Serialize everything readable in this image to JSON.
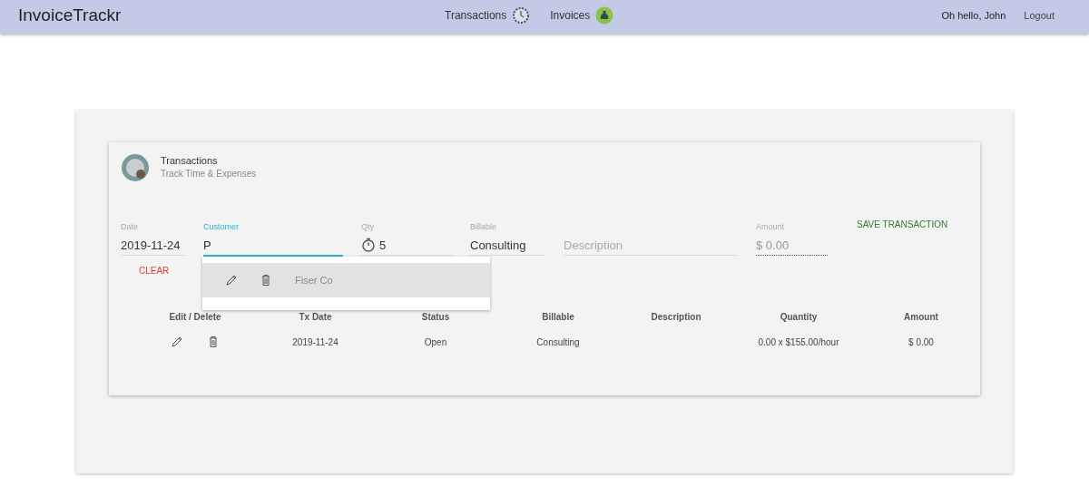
{
  "nav": {
    "brand": "InvoiceTrackr",
    "links": [
      {
        "label": "Transactions"
      },
      {
        "label": "Invoices"
      }
    ],
    "greeting": "Oh hello, John",
    "logout": "Logout"
  },
  "card": {
    "title": "Transactions",
    "subtitle": "Track Time & Expenses"
  },
  "fields": [
    {
      "kind": "text",
      "label": "Date",
      "value": "2019-11-24",
      "focused": false,
      "disabled": false
    },
    {
      "kind": "text",
      "label": "Customer",
      "value": "P",
      "focused": true,
      "disabled": false
    },
    {
      "kind": "qty",
      "label": "Qty",
      "value": "5",
      "focused": false,
      "disabled": false
    },
    {
      "kind": "text",
      "label": "Billable",
      "value": "Consulting",
      "focused": false,
      "disabled": false
    },
    {
      "kind": "text",
      "placeholder": "Description",
      "focused": false,
      "disabled": false
    },
    {
      "kind": "text",
      "label": "Amount",
      "value": "$ 0.00",
      "focused": false,
      "disabled": true
    }
  ],
  "save_button": "SAVE TRANSACTION",
  "clear_button": "CLEAR",
  "dropdown": {
    "items": [
      {
        "label": "Fiser Co",
        "selected": true
      }
    ]
  },
  "table": {
    "columns": [
      "Edit / Delete",
      "Tx Date",
      "Status",
      "Billable",
      "Description",
      "Quantity",
      "Amount"
    ],
    "rows": [
      {
        "date": "2019-11-24",
        "status": "Open",
        "billable": "Consulting",
        "quantity": "0.00 x $155.00/hour",
        "amount": "$ 0.00"
      }
    ]
  }
}
